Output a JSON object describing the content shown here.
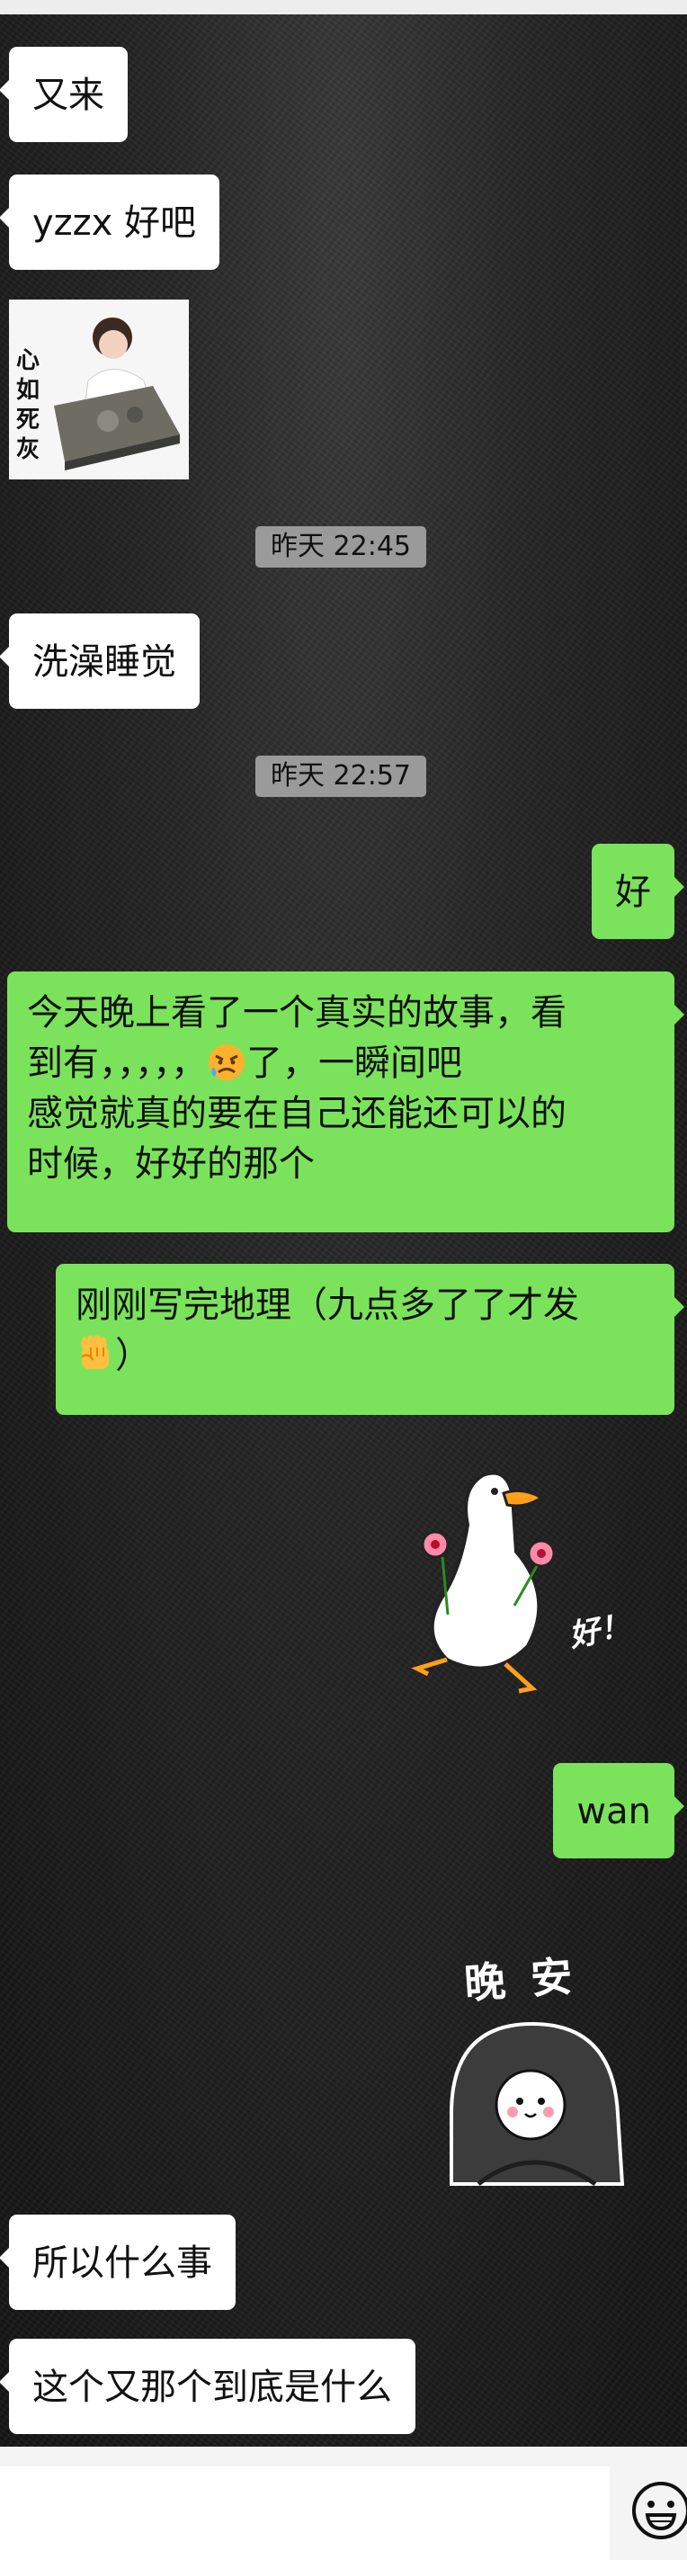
{
  "messages": {
    "m1": "又来",
    "m2": "yzzx 好吧",
    "m3": "洗澡睡觉",
    "m4": "好",
    "m5_a": "今天晚上看了一个真实的故事，看",
    "m5_b": "到有，，，，，",
    "m5_c": "了，一瞬间吧",
    "m5_d": "感觉就真的要在自己还能还可以的",
    "m5_e": "时候，好好的那个",
    "m6_a": "刚刚写完地理（九点多了了才发",
    "m6_b": "）",
    "m7": "wan",
    "m8": "所以什么事",
    "m9": "这个又那个到底是什么"
  },
  "timestamps": {
    "t1": "昨天 22:45",
    "t2": "昨天 22:57"
  },
  "stickers": {
    "face_text": "心如死灰",
    "goose_text": "好！",
    "goodnight_text": "晚 安"
  },
  "icons": {
    "angry_face": "angry-face-emoji",
    "fist": "raised-fist-emoji",
    "emoji_button": "smiley-face-icon"
  },
  "colors": {
    "outgoing_bubble": "#7be35b",
    "incoming_bubble": "#ffffff",
    "timestamp_bg": "#9a9a9a"
  }
}
